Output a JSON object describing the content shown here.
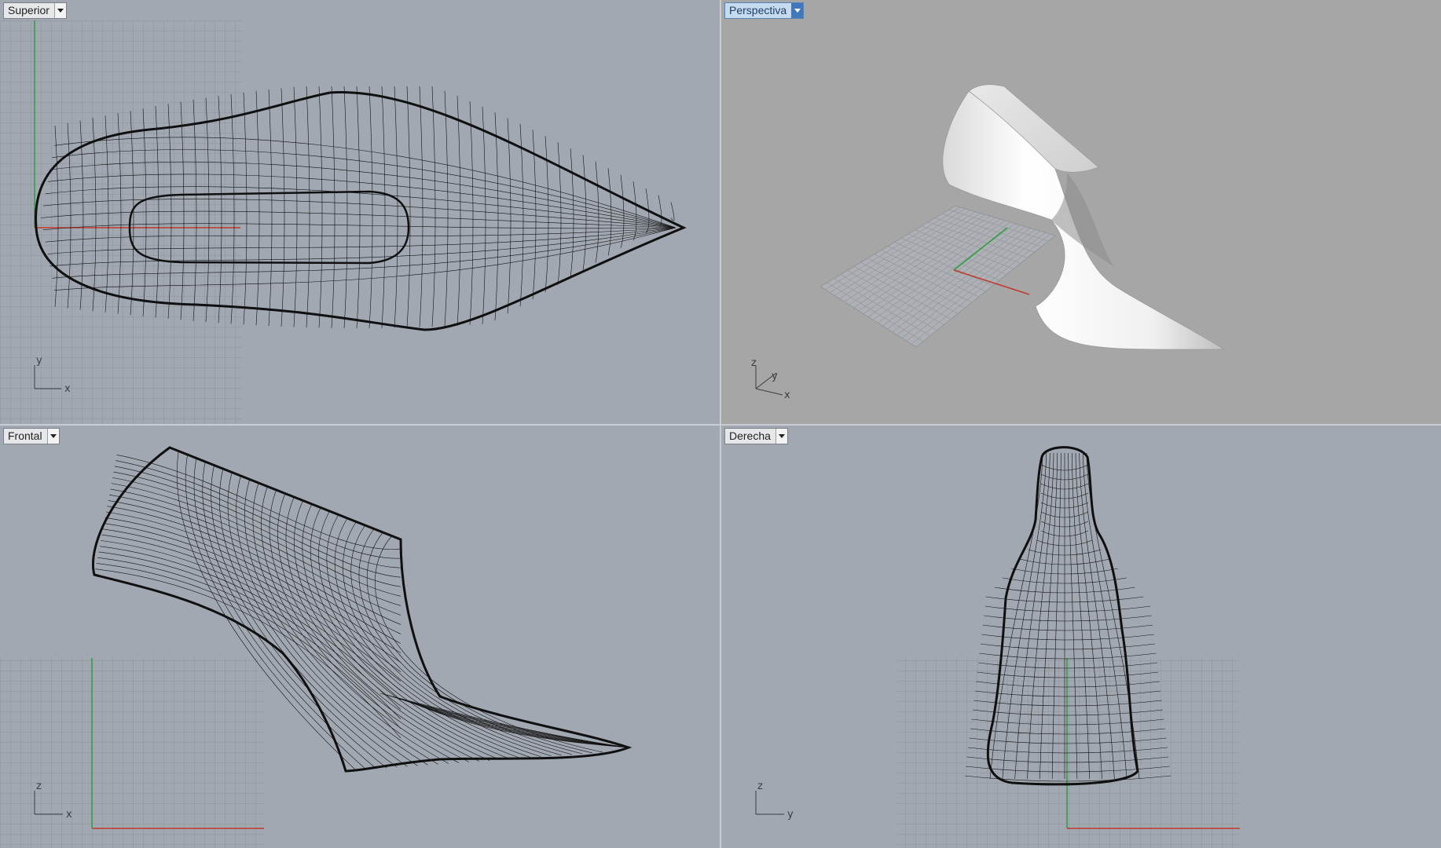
{
  "viewports": {
    "top": {
      "label": "Superior",
      "axis_labels": [
        "y",
        "x"
      ]
    },
    "perspective": {
      "label": "Perspectiva",
      "active": true,
      "axis_labels": [
        "z",
        "y",
        "x"
      ]
    },
    "front": {
      "label": "Frontal",
      "axis_labels": [
        "z",
        "x"
      ]
    },
    "right": {
      "label": "Derecha",
      "axis_labels": [
        "z",
        "y"
      ]
    }
  },
  "colors": {
    "viewport_bg": "#a2a8b1",
    "perspective_bg": "#a6a6a6",
    "grid_line": "#8e949c",
    "x_axis": "#c0392b",
    "y_axis": "#2e9e3e",
    "wire": "#101010",
    "active_tab": "#3f78bd"
  },
  "icons": {
    "viewport_menu": "chevron-down-icon"
  }
}
